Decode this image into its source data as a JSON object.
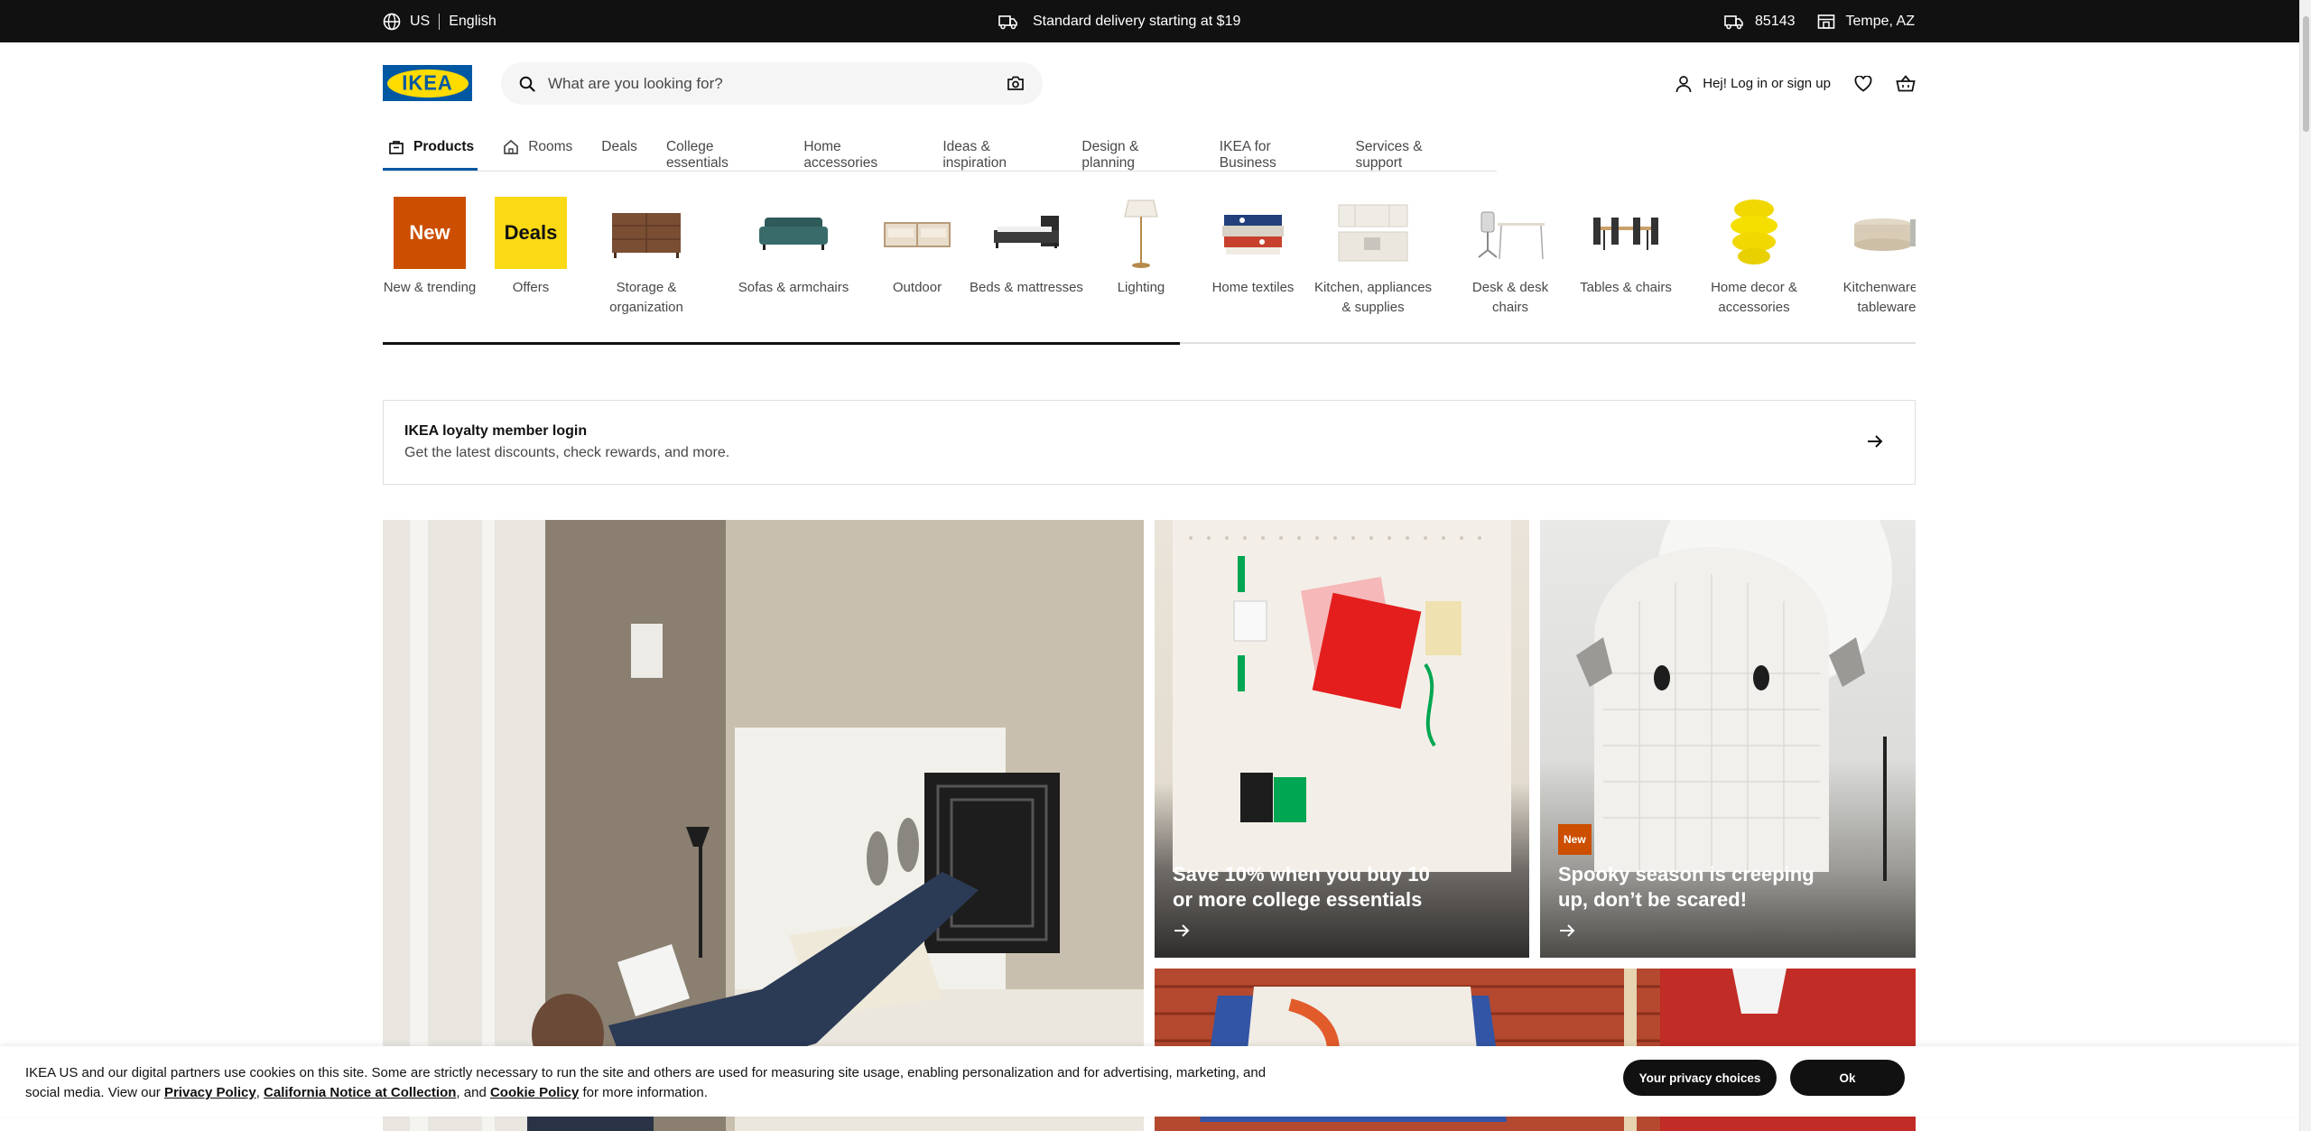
{
  "topbar": {
    "country": "US",
    "language": "English",
    "promo": "Standard delivery starting at $19",
    "zip": "85143",
    "store": "Tempe, AZ"
  },
  "header": {
    "logo_text": "IKEA",
    "search_placeholder": "What are you looking for?",
    "login_label": "Hej! Log in or sign up"
  },
  "nav": {
    "items": [
      {
        "label": "Products"
      },
      {
        "label": "Rooms"
      },
      {
        "label": "Deals"
      },
      {
        "label": "College essentials"
      },
      {
        "label": "Home accessories"
      },
      {
        "label": "Ideas & inspiration"
      },
      {
        "label": "Design & planning"
      },
      {
        "label": "IKEA for Business"
      },
      {
        "label": "Services & support"
      }
    ]
  },
  "categories": {
    "items": [
      {
        "label": "New & trending",
        "badge": "New"
      },
      {
        "label": "Offers",
        "badge": "Deals"
      },
      {
        "label": "Storage & organization"
      },
      {
        "label": "Sofas & armchairs"
      },
      {
        "label": "Outdoor"
      },
      {
        "label": "Beds & mattresses"
      },
      {
        "label": "Lighting"
      },
      {
        "label": "Home textiles"
      },
      {
        "label": "Kitchen, appliances & supplies"
      },
      {
        "label": "Desk & desk chairs"
      },
      {
        "label": "Tables & chairs"
      },
      {
        "label": "Home decor & accessories"
      },
      {
        "label": "Kitchenware & tableware"
      }
    ],
    "scroll_progress": 0.52
  },
  "loyalty": {
    "title": "IKEA loyalty member login",
    "subtitle": "Get the latest discounts, check rewards, and more."
  },
  "tiles": {
    "college": {
      "caption": "Save 10% when you buy 10 or more college essentials"
    },
    "spooky": {
      "badge": "New",
      "caption": "Spooky season is creeping up, don’t be scared!"
    }
  },
  "cookie": {
    "text_1": "IKEA US and our digital partners use cookies on this site. Some are strictly necessary to run the site and others are used for measuring site usage, enabling personalization and for advertising, marketing, and social media. View our ",
    "privacy_link": "Privacy Policy",
    "sep_1": ", ",
    "california_link": "California Notice at Collection",
    "sep_2": ", and ",
    "cookie_link": "Cookie Policy",
    "text_2": " for more information.",
    "privacy_button": "Your privacy choices",
    "ok_button": "Ok"
  },
  "colors": {
    "brand_blue": "#0058a3",
    "brand_yellow": "#ffdb00",
    "new_orange": "#cc4e00",
    "deals_yellow": "#fbd914"
  }
}
